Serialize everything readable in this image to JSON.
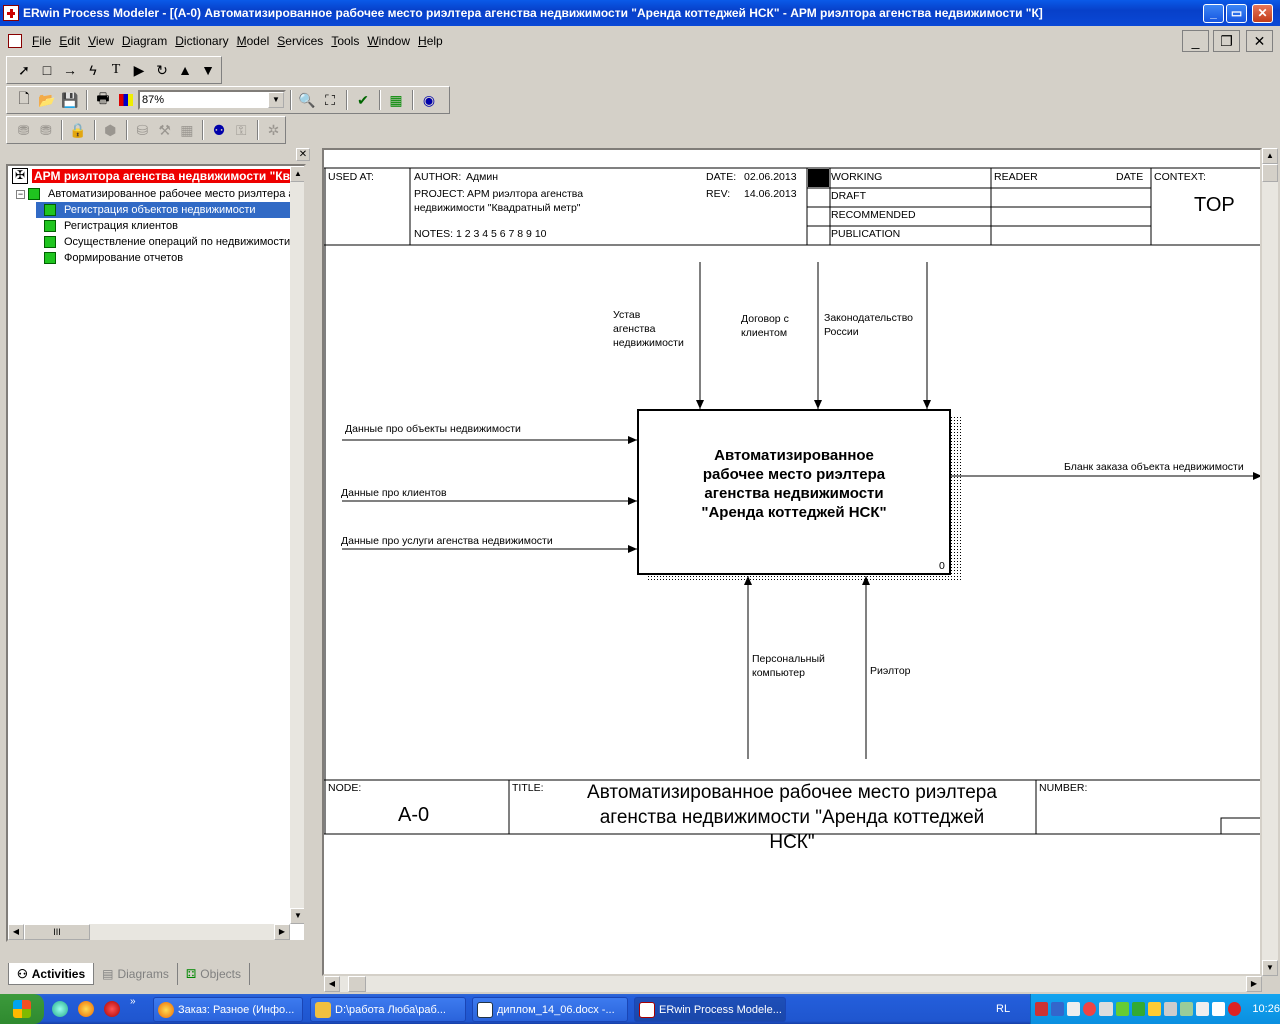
{
  "window": {
    "title": "ERwin Process Modeler - [(A-0) Автоматизированное  рабочее место риэлтера агенства недвижимости \"Аренда коттеджей НСК\" - АРМ риэлтора агенства недвижимости \"К]"
  },
  "menu": [
    "File",
    "Edit",
    "View",
    "Diagram",
    "Dictionary",
    "Model",
    "Services",
    "Tools",
    "Window",
    "Help"
  ],
  "toolbar": {
    "zoom_value": "87%"
  },
  "tree": {
    "root": "АРМ риэлтора агенства недвижимости \"Квадратный метр\"",
    "level1": "Автоматизированное  рабочее место риэлтера агенства недвижимости \"Аренда коттеджей НСК\"",
    "children": [
      "Регистрация объектов недвижимости",
      "Регистрация клиентов",
      "Осуществление операций по  недвижимости",
      "Формирование отчетов"
    ]
  },
  "scroll_label": "III",
  "tabs": [
    "Activities",
    "Diagrams",
    "Objects"
  ],
  "header": {
    "used_at": "USED AT:",
    "author_label": "AUTHOR:",
    "author": "Админ",
    "date_label": "DATE:",
    "date": "02.06.2013",
    "project_label": "PROJECT:",
    "project_line1": "АРМ риэлтора агенства",
    "project_line2": "недвижимости \"Квадратный метр\"",
    "rev_label": "REV:",
    "rev": "14.06.2013",
    "notes": "NOTES:  1  2  3  4  5  6  7  8  9  10",
    "status": [
      "WORKING",
      "DRAFT",
      "RECOMMENDED",
      "PUBLICATION"
    ],
    "reader": "READER",
    "date_col": "DATE",
    "context": "CONTEXT:",
    "context_value": "TOP"
  },
  "box": {
    "lines": [
      "Автоматизированное",
      "рабочее место риэлтера",
      "агенства недвижимости",
      "\"Аренда коттеджей НСК\""
    ],
    "number": "0"
  },
  "arrows": {
    "controls": [
      [
        "Устав",
        "агенства",
        "недвижимости"
      ],
      [
        "Договор с",
        "клиентом"
      ],
      [
        "Законодательство",
        "России"
      ]
    ],
    "inputs": [
      "Данные про объекты недвижимости",
      "Данные про клиентов",
      "Данные про услуги агенства недвижимости"
    ],
    "output": "Бланк заказа объекта недвижимости",
    "mechanisms": [
      [
        "Персональный",
        "компьютер"
      ],
      [
        "Риэлтор"
      ]
    ]
  },
  "footer": {
    "node_label": "NODE:",
    "node": "A-0",
    "title_label": "TITLE:",
    "title_lines": [
      "Автоматизированное  рабочее место риэлтера",
      "агенства недвижимости \"Аренда коттеджей",
      "НСК\""
    ],
    "number_label": "NUMBER:"
  },
  "taskbar": {
    "tasks": [
      "Заказ: Разное (Инфо...",
      "D:\\работа Люба\\раб...",
      "диплом_14_06.docx -...",
      "ERwin Process Modele..."
    ],
    "lang": "RL",
    "clock": "10:26"
  }
}
